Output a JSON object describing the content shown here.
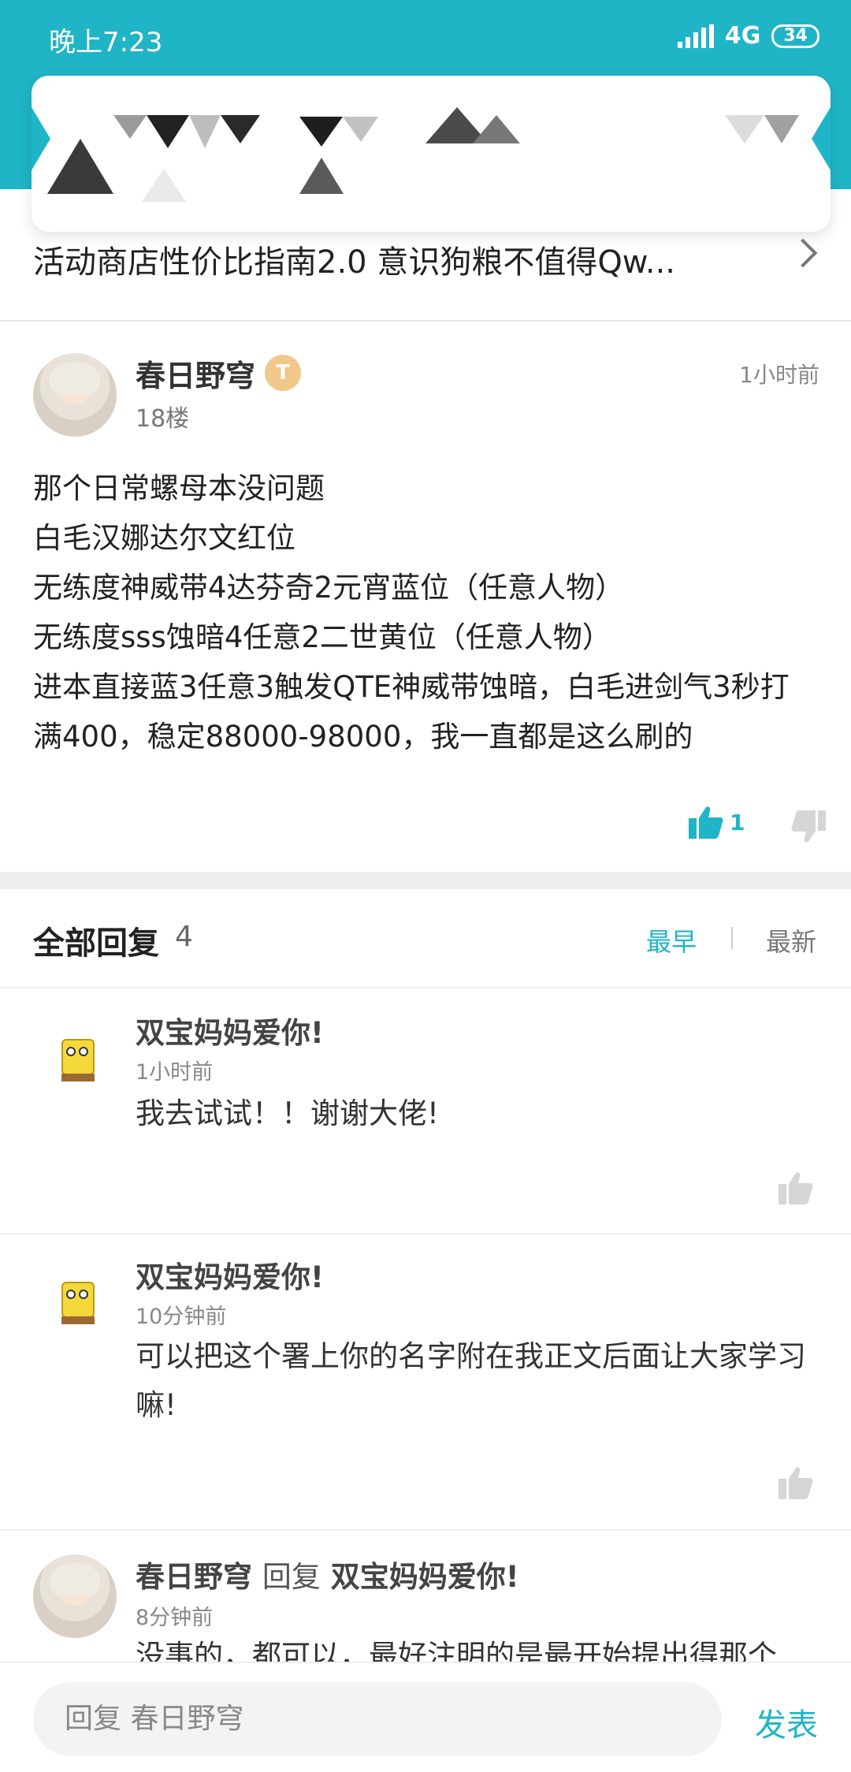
{
  "status_bar": {
    "time": "晚上7:23",
    "network": "4G",
    "battery": "34"
  },
  "post": {
    "title": "活动商店性价比指南2.0 意识狗粮不值得Qw...",
    "author": "春日野穹",
    "badge": "T",
    "floor": "18楼",
    "time": "1小时前",
    "lines": [
      "那个日常螺母本没问题",
      "白毛汉娜达尔文红位",
      "无练度神威带4达芬奇2元宵蓝位（任意人物）",
      "无练度sss蚀暗4任意2二世黄位（任意人物）",
      "进本直接蓝3任意3触发QTE神威带蚀暗，白毛进剑气3秒打",
      "满400，稳定88000-98000，我一直都是这么刷的"
    ],
    "likes": "1"
  },
  "replies": {
    "title": "全部回复",
    "count": "4",
    "sort_earliest": "最早",
    "sort_latest": "最新",
    "items": [
      {
        "name": "双宝妈妈爱你!",
        "time": "1小时前",
        "text": "我去试试！！谢谢大佬!"
      },
      {
        "name": "双宝妈妈爱你!",
        "time": "10分钟前",
        "text": "可以把这个署上你的名字附在我正文后面让大家学习嘛!"
      },
      {
        "name": "春日野穹",
        "reply_word": "回复",
        "reply_to": "双宝妈妈爱你!",
        "time": "8分钟前",
        "text": "没事的，都可以，最好注明的是最开始提出得那个"
      }
    ]
  },
  "composer": {
    "placeholder": "回复 春日野穹",
    "send": "发表"
  },
  "colors": {
    "accent": "#1fb5c6"
  }
}
